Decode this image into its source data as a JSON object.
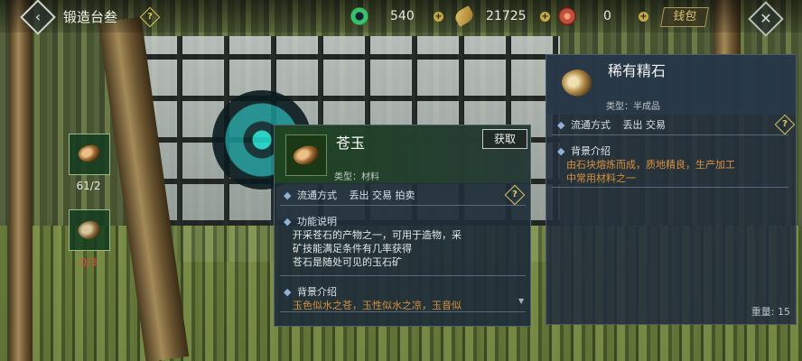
{
  "header": {
    "title": "锻造台叁",
    "currencies": [
      {
        "icon": "jade-coin-icon",
        "value": "540",
        "color": "#3cbf6a"
      },
      {
        "icon": "leaf-currency-icon",
        "value": "21725",
        "color": "#c8a040"
      },
      {
        "icon": "red-token-icon",
        "value": "0",
        "color": "#c0503a"
      }
    ],
    "bag_label": "钱包"
  },
  "materials": [
    {
      "count": "61/2",
      "count_color": "#e8e8e8"
    },
    {
      "count": "0/3",
      "count_color": "#e04a3a"
    }
  ],
  "item_panel": {
    "name": "苍玉",
    "get_label": "获取",
    "type_text": "类型：材料",
    "circulation_label": "流通方式",
    "circulation_values": "丢出 交易 拍卖",
    "function_title": "功能说明",
    "function_lines": [
      "开采苍石的产物之一，可用于造物，采",
      "矿技能满足条件有几率获得",
      "苍石是随处可见的玉石矿"
    ],
    "background_title": "背景介绍",
    "background_line": "玉色似水之苍，玉性似水之凉，玉音似"
  },
  "detail_panel": {
    "name": "稀有精石",
    "type_text": "类型：半成品",
    "circulation_label": "流通方式",
    "circulation_values": "丢出 交易",
    "background_title": "背景介绍",
    "background_lines": [
      "由石块熔炼而成，质地精良，生产加工",
      "中常用材料之一"
    ],
    "weight_text": "重量: 15"
  }
}
